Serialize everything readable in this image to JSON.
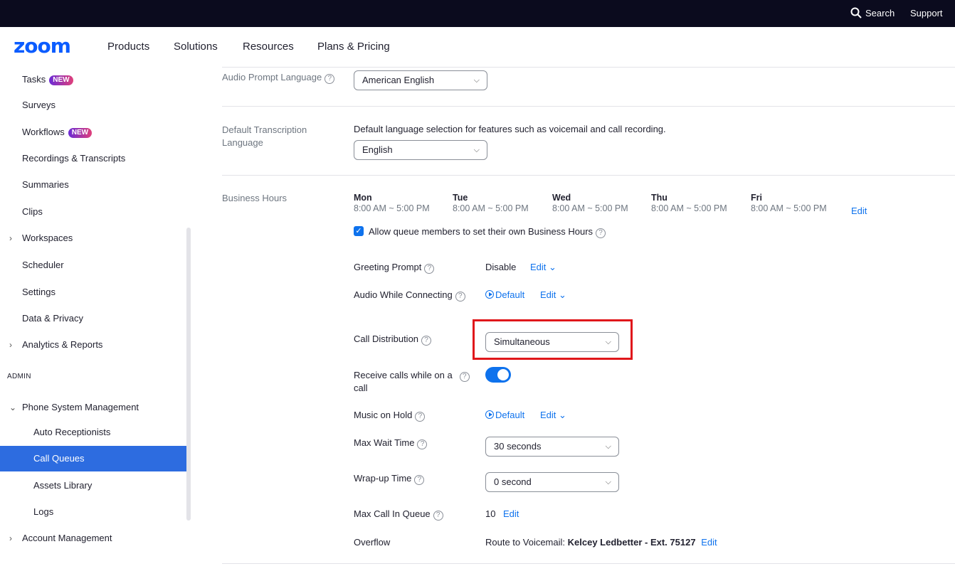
{
  "topbar": {
    "search_label": "Search",
    "support_label": "Support"
  },
  "nav": {
    "logo": "zoom",
    "links": [
      "Products",
      "Solutions",
      "Resources",
      "Plans & Pricing"
    ]
  },
  "sidebar": {
    "items": [
      {
        "label": "Tasks",
        "badge": "NEW"
      },
      {
        "label": "Surveys"
      },
      {
        "label": "Workflows",
        "badge": "NEW"
      },
      {
        "label": "Recordings & Transcripts"
      },
      {
        "label": "Summaries"
      },
      {
        "label": "Clips"
      },
      {
        "label": "Workspaces",
        "chevron": "›"
      },
      {
        "label": "Scheduler"
      },
      {
        "label": "Settings"
      },
      {
        "label": "Data & Privacy"
      },
      {
        "label": "Analytics & Reports",
        "chevron": "›"
      }
    ],
    "admin_heading": "ADMIN",
    "phone_system": {
      "label": "Phone System Management",
      "chevron": "⌄"
    },
    "sub_items": [
      "Auto Receptionists",
      "Call Queues",
      "Assets Library",
      "Logs"
    ],
    "account": {
      "label": "Account Management",
      "chevron": "›"
    },
    "active_item": "Call Queues"
  },
  "settings": {
    "audio_prompt": {
      "label": "Audio Prompt Language",
      "value": "American English"
    },
    "transcription": {
      "label_line1": "Default Transcription",
      "label_line2": "Language",
      "description": "Default language selection for features such as voicemail and call recording.",
      "value": "English"
    },
    "business_hours": {
      "label": "Business Hours",
      "days": [
        {
          "name": "Mon",
          "time": "8:00 AM ~ 5:00 PM"
        },
        {
          "name": "Tue",
          "time": "8:00 AM ~ 5:00 PM"
        },
        {
          "name": "Wed",
          "time": "8:00 AM ~ 5:00 PM"
        },
        {
          "name": "Thu",
          "time": "8:00 AM ~ 5:00 PM"
        },
        {
          "name": "Fri",
          "time": "8:00 AM ~ 5:00 PM"
        }
      ],
      "edit_label": "Edit",
      "allow_checkbox_label": "Allow queue members to set their own Business Hours",
      "allow_checked": true
    },
    "greeting_prompt": {
      "label": "Greeting Prompt",
      "value": "Disable",
      "edit": "Edit ⌄"
    },
    "audio_connecting": {
      "label": "Audio While Connecting",
      "value": "Default",
      "edit": "Edit ⌄"
    },
    "call_distribution": {
      "label": "Call Distribution",
      "value": "Simultaneous"
    },
    "receive_calls": {
      "label_line1": "Receive calls while on a",
      "label_line2": "call",
      "enabled": true
    },
    "music_on_hold": {
      "label": "Music on Hold",
      "value": "Default",
      "edit": "Edit ⌄"
    },
    "max_wait": {
      "label": "Max Wait Time",
      "value": "30 seconds"
    },
    "wrap_up": {
      "label": "Wrap-up Time",
      "value": "0 second"
    },
    "max_queue": {
      "label": "Max Call In Queue",
      "value": "10",
      "edit": "Edit"
    },
    "overflow": {
      "label": "Overflow",
      "prefix": "Route to Voicemail:",
      "target": "Kelcey Ledbetter - Ext. 75127",
      "edit": "Edit"
    }
  },
  "colors": {
    "accent": "#0e72ed",
    "active_bg": "#2d6ce0",
    "highlight": "#e0171b",
    "topbar": "#0b0b1e"
  }
}
